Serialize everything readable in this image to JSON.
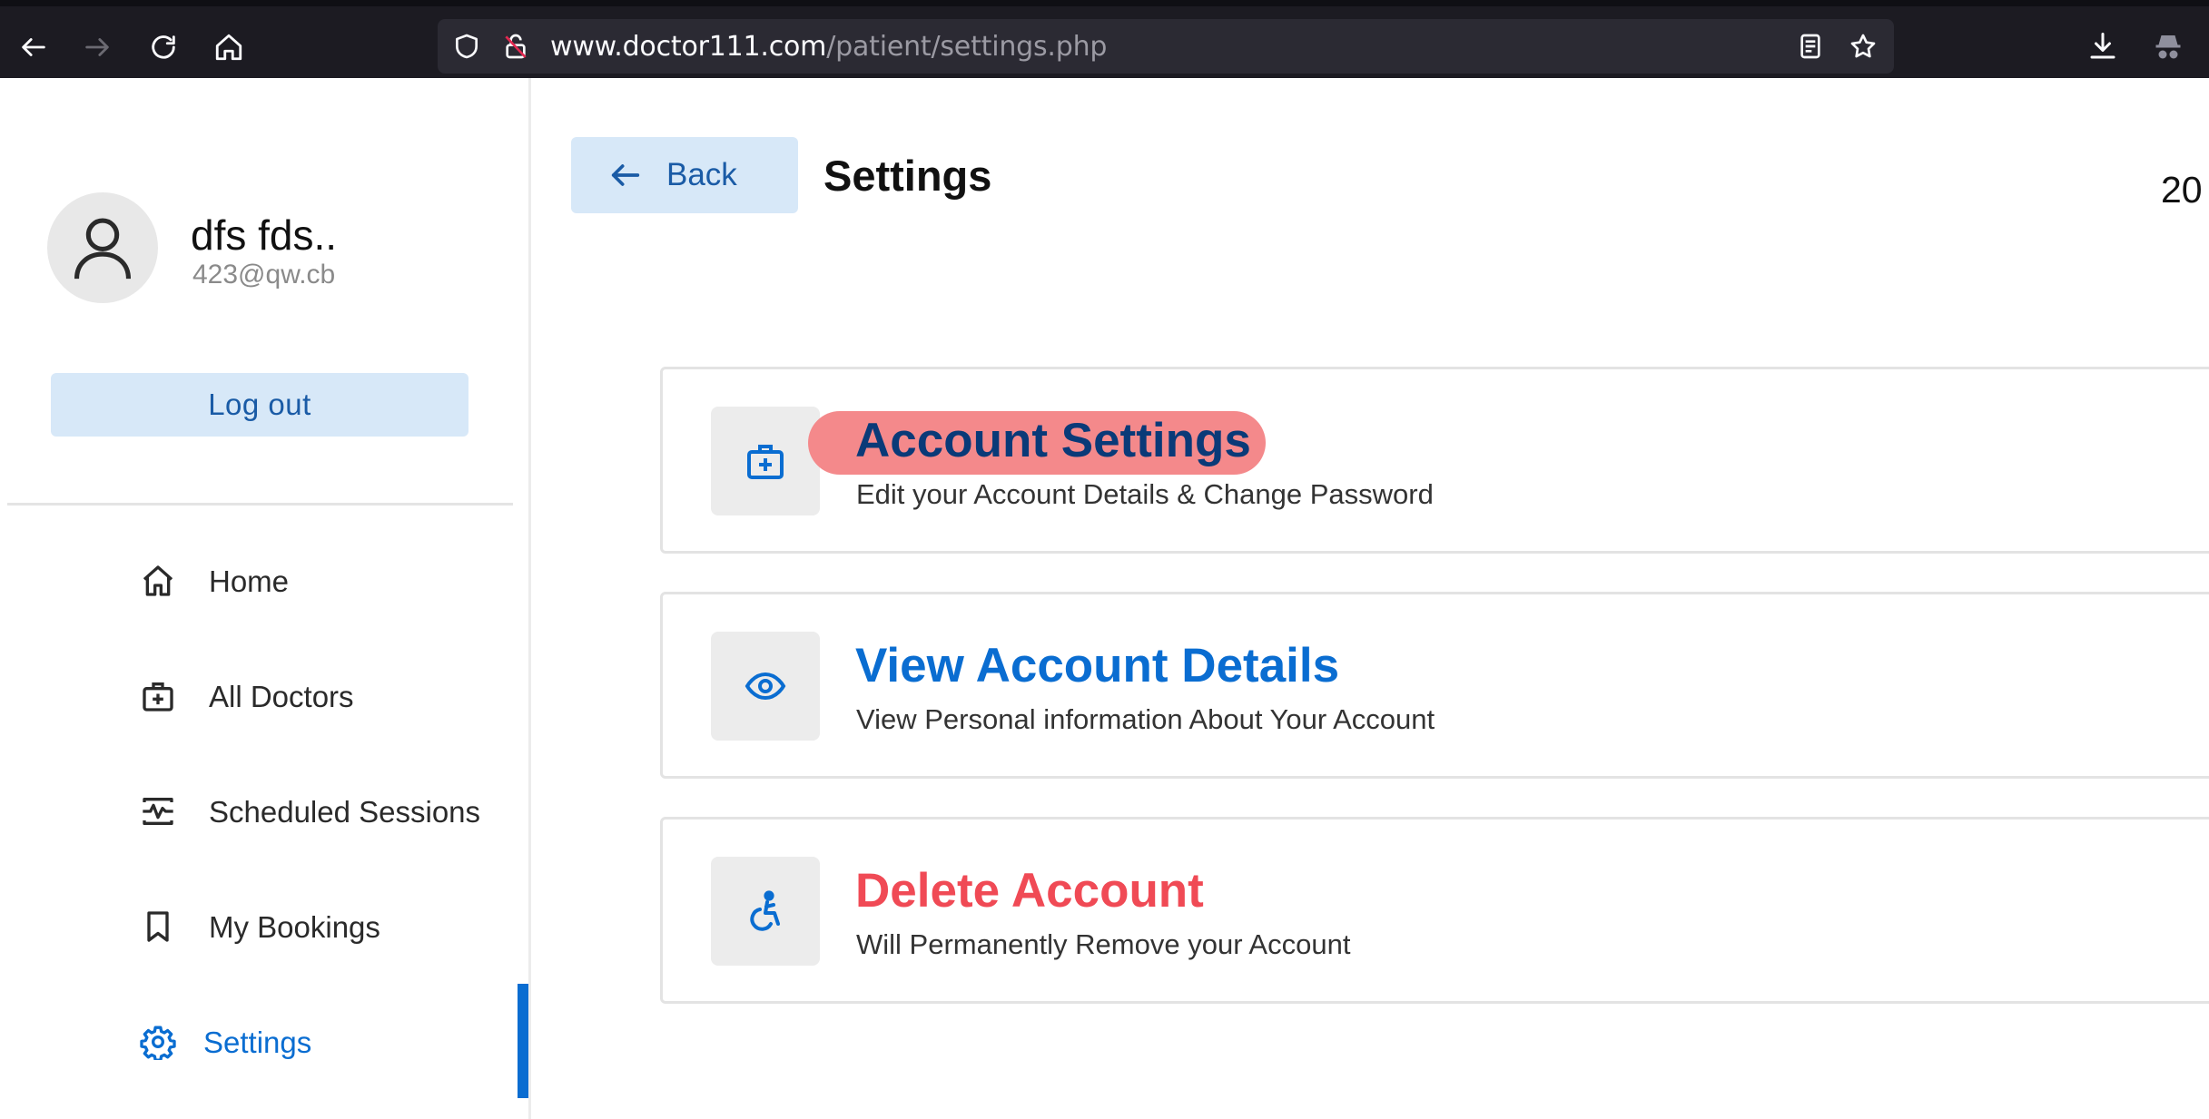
{
  "browser": {
    "url_host": "www.doctor111.com",
    "url_path": "/patient/settings.php"
  },
  "sidebar": {
    "user_name": "dfs fds..",
    "user_email": "423@qw.cb",
    "logout_label": "Log out",
    "items": [
      {
        "label": "Home",
        "icon": "home-icon"
      },
      {
        "label": "All Doctors",
        "icon": "medical-bag-icon"
      },
      {
        "label": "Scheduled Sessions",
        "icon": "schedule-pulse-icon"
      },
      {
        "label": "My Bookings",
        "icon": "bookmark-icon"
      },
      {
        "label": "Settings",
        "icon": "gear-icon",
        "active": true
      }
    ]
  },
  "header": {
    "back_label": "Back",
    "title": "Settings",
    "date_fragment": "20"
  },
  "cards": [
    {
      "title": "Account Settings",
      "description": "Edit your Account Details & Change Password",
      "icon": "medical-bag-icon",
      "color": "#0a3a78",
      "highlighted": true
    },
    {
      "title": "View Account Details",
      "description": "View Personal information About Your Account",
      "icon": "eye-icon",
      "color": "#0a6dd1"
    },
    {
      "title": "Delete Account",
      "description": "Will Permanently Remove your Account",
      "icon": "accessibility-icon",
      "color": "#f04a55"
    }
  ],
  "colors": {
    "accent": "#0a6dd1",
    "button_bg": "#d7e8f8",
    "highlight": "#f4898b",
    "danger": "#f04a55"
  }
}
